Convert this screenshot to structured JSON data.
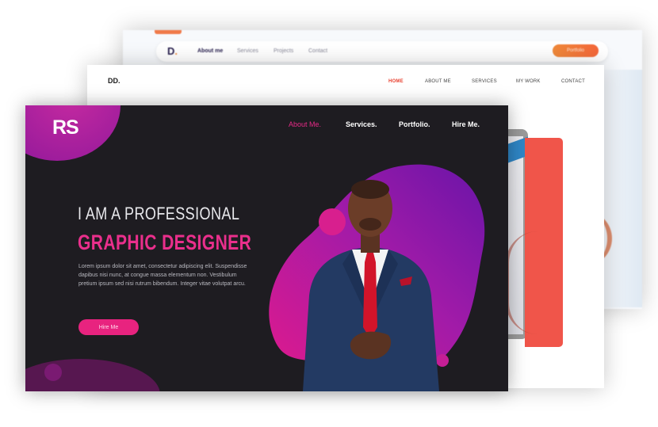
{
  "back_card": {
    "logo_letter": "D",
    "logo_dot": ".",
    "nav": [
      "About me",
      "Services",
      "Projects",
      "Contact"
    ],
    "cta": "Portfolio",
    "colors": {
      "accent": "#f07a4a",
      "navy": "#2a2250"
    }
  },
  "mid_card": {
    "logo": "DD.",
    "nav": [
      "HOME",
      "ABOUT ME",
      "SERVICES",
      "MY WORK",
      "CONTACT"
    ],
    "active_nav": "HOME",
    "colors": {
      "accent": "#e8402f",
      "panel": "#f0554a"
    }
  },
  "front_card": {
    "logo": "RS",
    "nav": [
      "About Me.",
      "Services.",
      "Portfolio.",
      "Hire Me."
    ],
    "active_nav": "About Me.",
    "headline_1": "I AM A PROFESSIONAL",
    "headline_2": "GRAPHIC DESIGNER",
    "body": "Lorem ipsum dolor sit amet, consectetur adipiscing elit. Suspendisse dapibus nisi nunc, at congue massa elementum non. Vestibulum pretium ipsum sed nisi rutrum bibendum. Integer vitae volutpat arcu.",
    "cta": "Hire Me",
    "colors": {
      "background": "#1e1c21",
      "accent": "#e8237f",
      "blob": "#8a169a"
    }
  }
}
